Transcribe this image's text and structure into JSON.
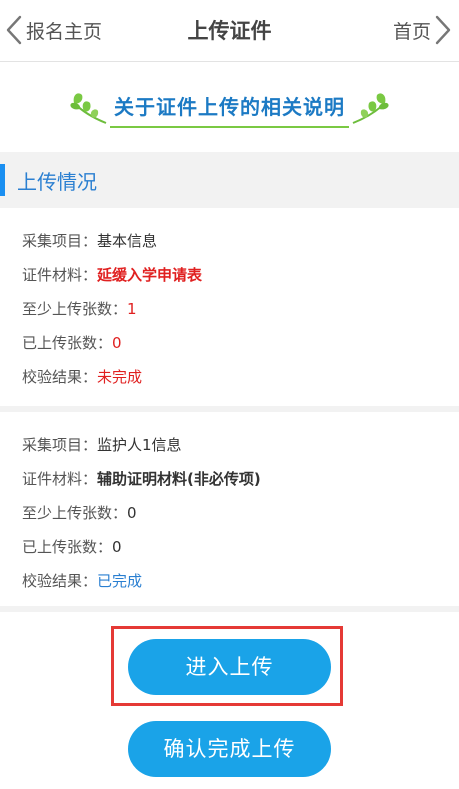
{
  "header": {
    "back_label": "报名主页",
    "title": "上传证件",
    "home_label": "首页"
  },
  "banner": {
    "text": "关于证件上传的相关说明"
  },
  "section": {
    "title": "上传情况"
  },
  "items": [
    {
      "rows": [
        {
          "label": "采集项目：",
          "value": "基本信息"
        },
        {
          "label": "证件材料：",
          "value": "延缓入学申请表"
        },
        {
          "label": "至少上传张数：",
          "value": "1"
        },
        {
          "label": "已上传张数：",
          "value": "0"
        },
        {
          "label": "校验结果：",
          "value": "未完成"
        }
      ]
    },
    {
      "rows": [
        {
          "label": "采集项目：",
          "value": "监护人1信息"
        },
        {
          "label": "证件材料：",
          "value": "辅助证明材料(非必传项)"
        },
        {
          "label": "至少上传张数：",
          "value": "0"
        },
        {
          "label": "已上传张数：",
          "value": "0"
        },
        {
          "label": "校验结果：",
          "value": "已完成"
        }
      ]
    }
  ],
  "buttons": {
    "enter_upload": "进入上传",
    "confirm_upload": "确认完成上传"
  },
  "colors": {
    "accent": "#1aa3e8",
    "title_blue": "#1c7ac4",
    "red": "#e02020",
    "highlight_box": "#e53935"
  }
}
